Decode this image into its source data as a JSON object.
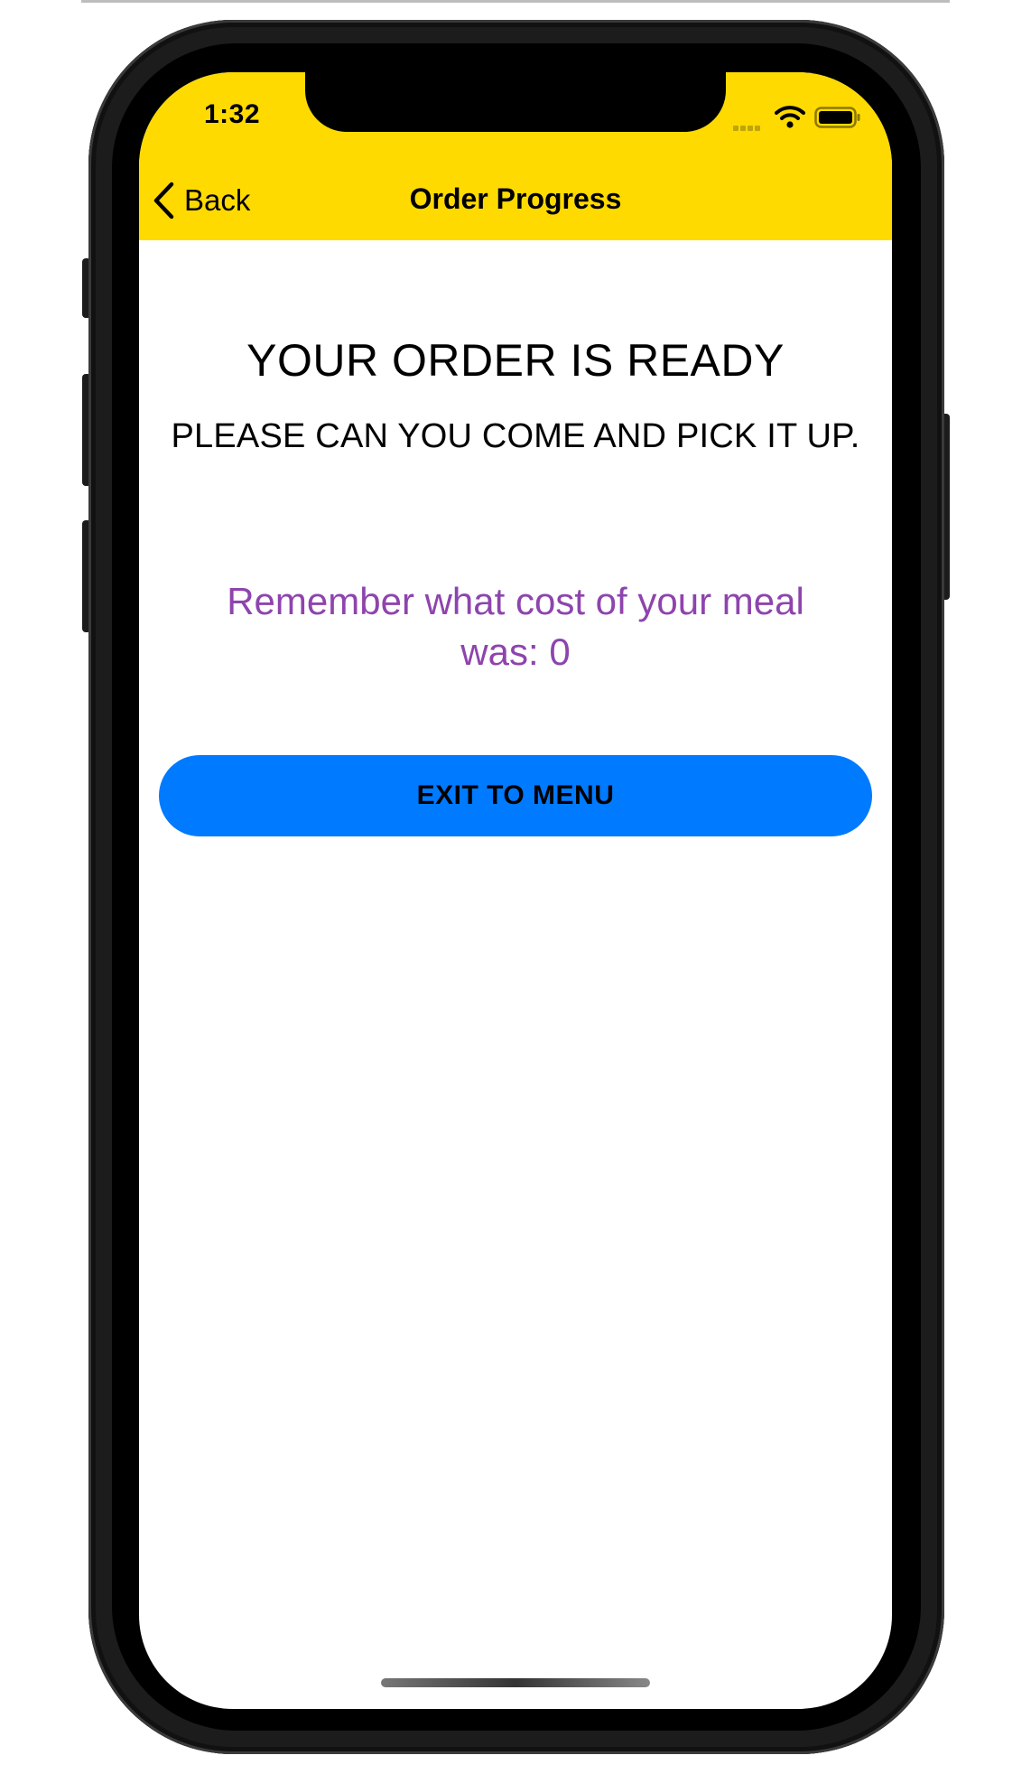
{
  "status_bar": {
    "time": "1:32"
  },
  "nav_bar": {
    "back_label": "Back",
    "title": "Order Progress",
    "background_color": "#ffda00"
  },
  "content": {
    "heading": "YOUR ORDER IS READY",
    "subheading": "PLEASE CAN YOU COME AND PICK IT UP.",
    "cost_message": "Remember what cost of your meal was: 0",
    "cost_message_color": "#8e44ad"
  },
  "actions": {
    "exit_label": "EXIT TO MENU",
    "exit_color": "#007aff"
  },
  "icons": {
    "back": "chevron-left-icon",
    "signal": "cellular-signal-icon",
    "wifi": "wifi-icon",
    "battery": "battery-icon"
  }
}
